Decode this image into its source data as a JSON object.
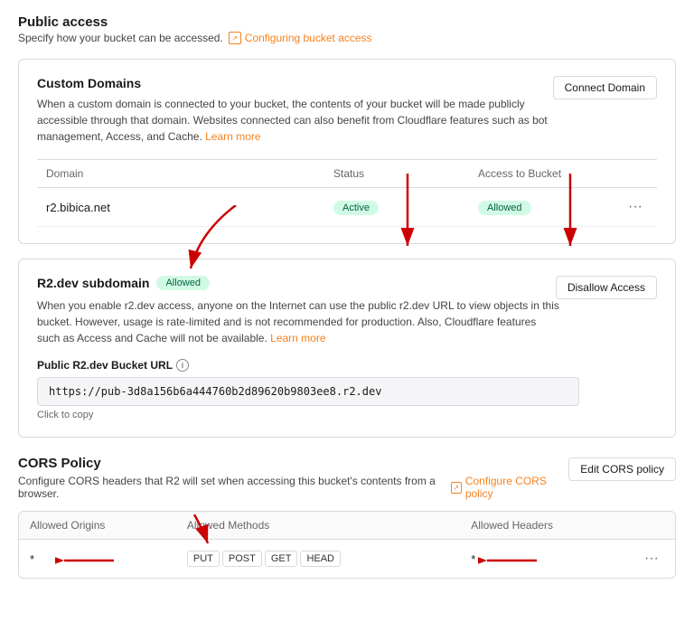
{
  "page": {
    "title": "Public access",
    "subtitle": "Specify how your bucket can be accessed.",
    "config_link": "Configuring bucket access"
  },
  "custom_domains": {
    "title": "Custom Domains",
    "description": "When a custom domain is connected to your bucket, the contents of your bucket will be made publicly accessible through that domain. Websites connected can also benefit from Cloudflare features such as bot management, Access, and Cache.",
    "learn_more": "Learn more",
    "connect_btn": "Connect Domain",
    "table": {
      "columns": [
        "Domain",
        "Status",
        "Access to Bucket"
      ],
      "rows": [
        {
          "domain": "r2.bibica.net",
          "status": "Active",
          "access": "Allowed"
        }
      ]
    }
  },
  "r2_subdomain": {
    "title": "R2.dev subdomain",
    "allowed_badge": "Allowed",
    "description": "When you enable r2.dev access, anyone on the Internet can use the public r2.dev URL to view objects in this bucket. However, usage is rate-limited and is not recommended for production. Also, Cloudflare features such as Access and Cache will not be available.",
    "learn_more": "Learn more",
    "url_label": "Public R2.dev Bucket URL",
    "url_value": "https://pub-3d8a156b6a444760b2d89620b9803ee8.r2.dev",
    "click_to_copy": "Click to copy",
    "disallow_btn": "Disallow Access"
  },
  "cors_policy": {
    "title": "CORS Policy",
    "description": "Configure CORS headers that R2 will set when accessing this bucket's contents from a browser.",
    "configure_link": "Configure CORS policy",
    "edit_btn": "Edit CORS policy",
    "table": {
      "columns": [
        "Allowed Origins",
        "Allowed Methods",
        "Allowed Headers"
      ],
      "rows": [
        {
          "origins": "*",
          "methods": [
            "PUT",
            "POST",
            "GET",
            "HEAD"
          ],
          "headers": "*"
        }
      ]
    }
  },
  "arrows": {
    "note": "decorative red arrows in screenshot"
  }
}
